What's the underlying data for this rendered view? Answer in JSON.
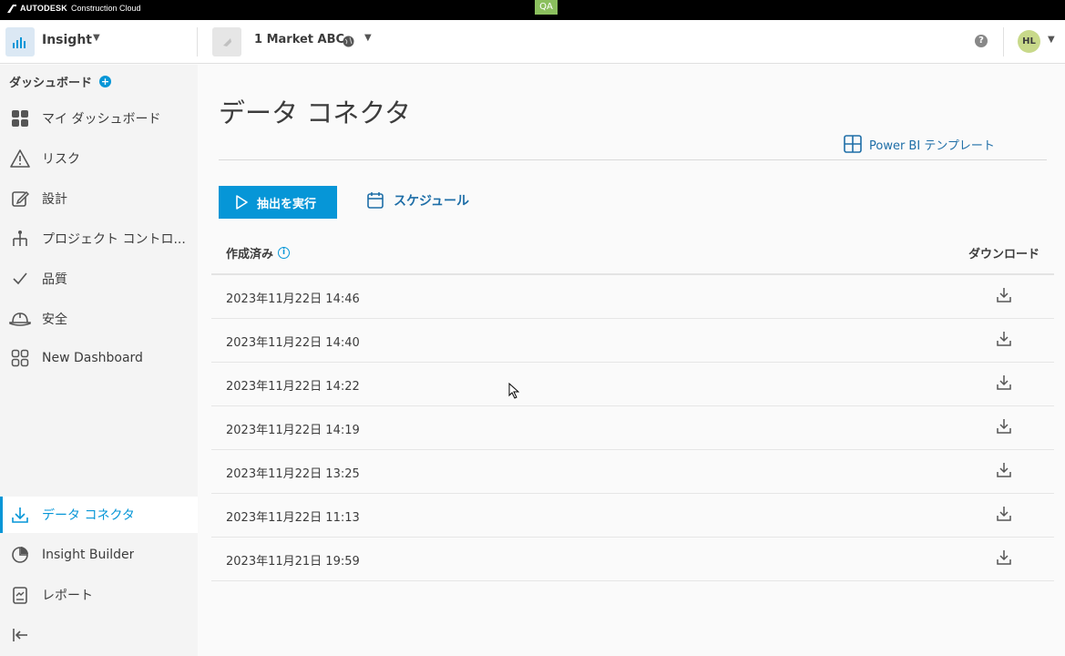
{
  "topbar": {
    "brand_bold": "AUTODESK",
    "brand_light": "Construction Cloud",
    "env_badge": "QA"
  },
  "header": {
    "module_name": "Insight",
    "project_name": "1 Market ABC",
    "user_initials": "HL"
  },
  "sidebar": {
    "section_title": "ダッシュボード",
    "items": [
      {
        "label": "マイ ダッシュボード",
        "icon": "grid-icon"
      },
      {
        "label": "リスク",
        "icon": "warning-icon"
      },
      {
        "label": "設計",
        "icon": "edit-icon"
      },
      {
        "label": "プロジェクト コントロ...",
        "icon": "hierarchy-icon"
      },
      {
        "label": "品質",
        "icon": "check-icon"
      },
      {
        "label": "安全",
        "icon": "hardhat-icon"
      },
      {
        "label": "New Dashboard",
        "icon": "grid-outline-icon"
      }
    ],
    "bottom_items": [
      {
        "label": "データ コネクタ",
        "icon": "download-icon",
        "active": true
      },
      {
        "label": "Insight Builder",
        "icon": "pie-icon"
      },
      {
        "label": "レポート",
        "icon": "report-icon"
      }
    ]
  },
  "main": {
    "title": "データ コネクタ",
    "powerbi_label": "Power BI テンプレート",
    "run_label": "抽出を実行",
    "schedule_label": "スケジュール",
    "col_created": "作成済み",
    "col_download": "ダウンロード",
    "rows": [
      "2023年11月22日 14:46",
      "2023年11月22日 14:40",
      "2023年11月22日 14:22",
      "2023年11月22日 14:19",
      "2023年11月22日 13:25",
      "2023年11月22日 11:13",
      "2023年11月21日 19:59"
    ]
  },
  "colors": {
    "accent": "#0696d7",
    "link": "#1e6ea7",
    "avatar": "#c8d98a",
    "qa": "#8bbf5e"
  }
}
